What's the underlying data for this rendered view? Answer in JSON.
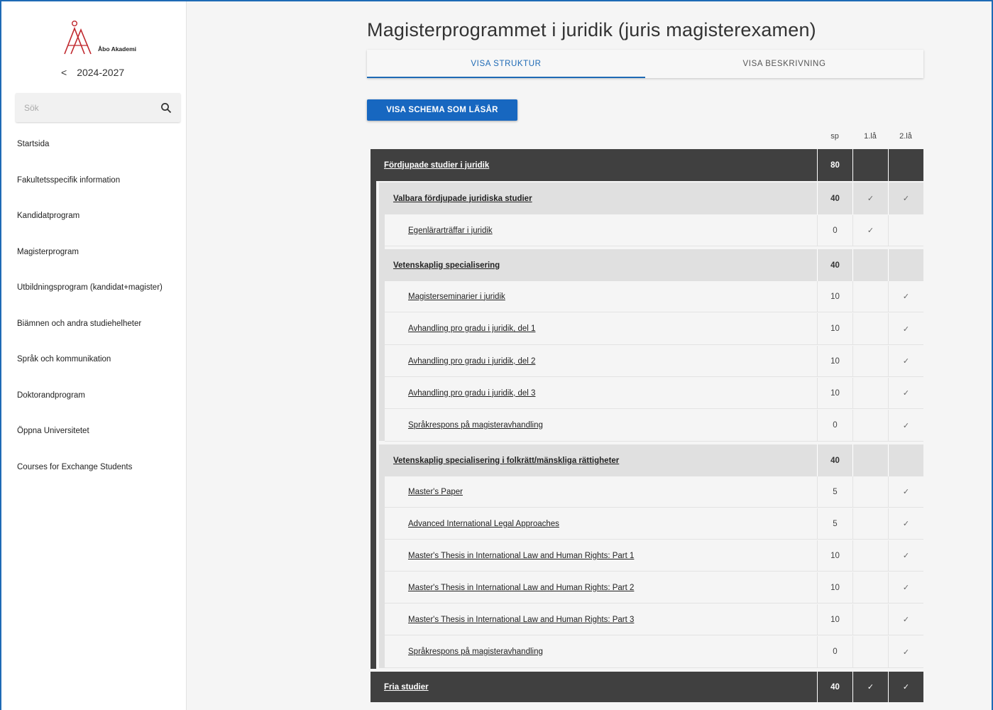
{
  "sidebar": {
    "logo_text": "Åbo Akademi",
    "year": "2024-2027",
    "search_placeholder": "Sök",
    "nav": [
      "Startsida",
      "Fakultetsspecifik information",
      "Kandidatprogram",
      "Magisterprogram",
      "Utbildningsprogram (kandidat+magister)",
      "Biämnen och andra studiehelheter",
      "Språk och kommunikation",
      "Doktorandprogram",
      "Öppna Universitetet",
      "Courses for Exchange Students"
    ]
  },
  "main": {
    "title": "Magisterprogrammet i juridik (juris magisterexamen)",
    "tabs": [
      "VISA STRUKTUR",
      "VISA BESKRIVNING"
    ],
    "schema_button": "VISA SCHEMA SOM LÄSÅR",
    "columns": {
      "sp": "sp",
      "y1": "1.lå",
      "y2": "2.lå"
    },
    "check_symbol": "✓",
    "rows": [
      {
        "level": "dark",
        "name": "Fördjupade studier i juridik",
        "sp": "80",
        "y1": "",
        "y2": ""
      },
      {
        "level": "mid",
        "name": "Valbara fördjupade juridiska studier",
        "sp": "40",
        "y1": "✓",
        "y2": "✓"
      },
      {
        "level": "light",
        "name": "Egenlärarträffar i juridik",
        "sp": "0",
        "y1": "✓",
        "y2": ""
      },
      {
        "level": "mid",
        "name": "Vetenskaplig specialisering",
        "sp": "40",
        "y1": "",
        "y2": ""
      },
      {
        "level": "light",
        "name": "Magisterseminarier i juridik",
        "sp": "10",
        "y1": "",
        "y2": "✓"
      },
      {
        "level": "light",
        "name": "Avhandling pro gradu i juridik, del 1",
        "sp": "10",
        "y1": "",
        "y2": "✓"
      },
      {
        "level": "light",
        "name": "Avhandling pro gradu i juridik, del 2",
        "sp": "10",
        "y1": "",
        "y2": "✓"
      },
      {
        "level": "light",
        "name": "Avhandling pro gradu i juridik, del 3",
        "sp": "10",
        "y1": "",
        "y2": "✓"
      },
      {
        "level": "light",
        "name": "Språkrespons på magisteravhandling",
        "sp": "0",
        "y1": "",
        "y2": "✓"
      },
      {
        "level": "mid",
        "name": "Vetenskaplig specialisering i folkrätt/mänskliga rättigheter",
        "sp": "40",
        "y1": "",
        "y2": ""
      },
      {
        "level": "light",
        "name": "Master's Paper",
        "sp": "5",
        "y1": "",
        "y2": "✓"
      },
      {
        "level": "light",
        "name": "Advanced International Legal Approaches",
        "sp": "5",
        "y1": "",
        "y2": "✓"
      },
      {
        "level": "light",
        "name": "Master's Thesis in International Law and Human Rights: Part 1",
        "sp": "10",
        "y1": "",
        "y2": "✓"
      },
      {
        "level": "light",
        "name": "Master's Thesis in International Law and Human Rights: Part 2",
        "sp": "10",
        "y1": "",
        "y2": "✓"
      },
      {
        "level": "light",
        "name": "Master's Thesis in International Law and Human Rights: Part 3",
        "sp": "10",
        "y1": "",
        "y2": "✓"
      },
      {
        "level": "light",
        "name": "Språkrespons på magisteravhandling",
        "sp": "0",
        "y1": "",
        "y2": "✓"
      },
      {
        "level": "dark",
        "name": "Fria studier",
        "sp": "40",
        "y1": "✓",
        "y2": "✓"
      }
    ]
  },
  "colors": {
    "accent": "#1e6ab5",
    "button": "#1767c0",
    "dark_row": "#404040",
    "mid_row": "#e0e0e0",
    "logo_red": "#c0282e"
  }
}
